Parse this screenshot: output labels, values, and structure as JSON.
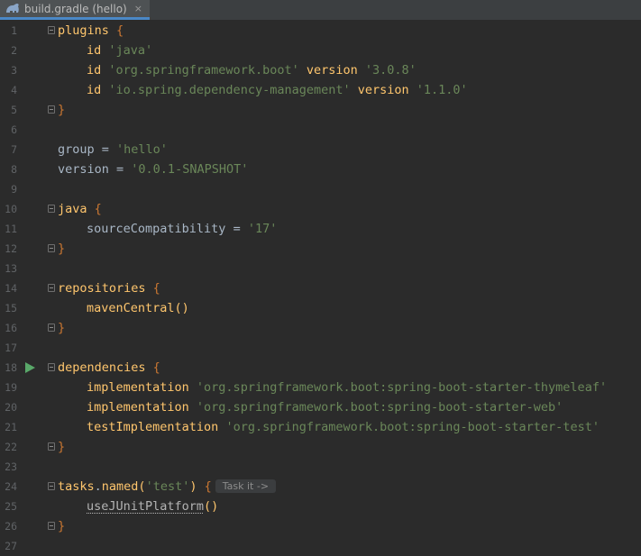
{
  "tab": {
    "title": "build.gradle (hello)",
    "close": "×",
    "icon": "gradle-elephant-icon"
  },
  "colors": {
    "background": "#2b2b2b",
    "text": "#a9b7c6",
    "method": "#ffc66d",
    "string": "#6a8759",
    "keyword": "#cc7832",
    "line_number": "#606366",
    "run_icon": "#59a869"
  },
  "lines": [
    {
      "n": "1",
      "a": "plugins ",
      "b": "{"
    },
    {
      "n": "2",
      "a": "id ",
      "b": "'java'"
    },
    {
      "n": "3",
      "a": "id ",
      "b": "'org.springframework.boot'",
      "c": " version ",
      "d": "'3.0.8'"
    },
    {
      "n": "4",
      "a": "id ",
      "b": "'io.spring.dependency-management'",
      "c": " version ",
      "d": "'1.1.0'"
    },
    {
      "n": "5",
      "a": "}"
    },
    {
      "n": "6"
    },
    {
      "n": "7",
      "a": "group",
      "b": " = ",
      "c": "'hello'"
    },
    {
      "n": "8",
      "a": "version",
      "b": " = ",
      "c": "'0.0.1-SNAPSHOT'"
    },
    {
      "n": "9"
    },
    {
      "n": "10",
      "a": "java ",
      "b": "{"
    },
    {
      "n": "11",
      "a": "sourceCompatibility",
      "b": " = ",
      "c": "'17'"
    },
    {
      "n": "12",
      "a": "}"
    },
    {
      "n": "13"
    },
    {
      "n": "14",
      "a": "repositories ",
      "b": "{"
    },
    {
      "n": "15",
      "a": "mavenCentral()"
    },
    {
      "n": "16",
      "a": "}"
    },
    {
      "n": "17"
    },
    {
      "n": "18",
      "a": "dependencies ",
      "b": "{"
    },
    {
      "n": "19",
      "a": "implementation ",
      "b": "'org.springframework.boot:spring-boot-starter-thymeleaf'"
    },
    {
      "n": "20",
      "a": "implementation ",
      "b": "'org.springframework.boot:spring-boot-starter-web'"
    },
    {
      "n": "21",
      "a": "testImplementation ",
      "b": "'org.springframework.boot:spring-boot-starter-test'"
    },
    {
      "n": "22",
      "a": "}"
    },
    {
      "n": "23"
    },
    {
      "n": "24",
      "a": "tasks",
      "b": ".",
      "c": "named(",
      "d": "'test'",
      "e": ") ",
      "f": "{",
      "hint": "Task it ->"
    },
    {
      "n": "25",
      "a": "useJUnitPlatform",
      "b": "()"
    },
    {
      "n": "26",
      "a": "}"
    },
    {
      "n": "27"
    }
  ]
}
